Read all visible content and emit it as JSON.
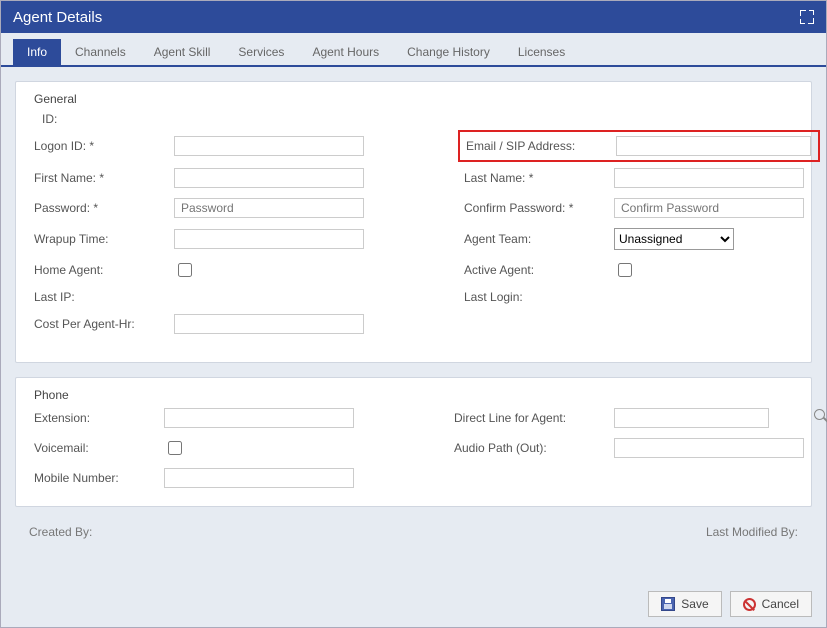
{
  "window": {
    "title": "Agent Details"
  },
  "tabs": [
    {
      "label": "Info",
      "active": true
    },
    {
      "label": "Channels"
    },
    {
      "label": "Agent Skill"
    },
    {
      "label": "Services"
    },
    {
      "label": "Agent Hours"
    },
    {
      "label": "Change History"
    },
    {
      "label": "Licenses"
    }
  ],
  "general": {
    "title": "General",
    "id_label": "ID:",
    "logon_label": "Logon ID: *",
    "email_label": "Email / SIP Address:",
    "firstname_label": "First Name: *",
    "lastname_label": "Last Name: *",
    "password_label": "Password:  *",
    "password_placeholder": "Password",
    "confirm_label": "Confirm Password: *",
    "confirm_placeholder": "Confirm Password",
    "wrapup_label": "Wrapup Time:",
    "team_label": "Agent Team:",
    "team_selected": "Unassigned",
    "home_label": "Home Agent:",
    "active_label": "Active Agent:",
    "lastip_label": "Last IP:",
    "lastlogin_label": "Last Login:",
    "cost_label": "Cost Per Agent-Hr:"
  },
  "phone": {
    "title": "Phone",
    "extension_label": "Extension:",
    "directline_label": "Direct Line for Agent:",
    "voicemail_label": "Voicemail:",
    "audiopath_label": "Audio Path (Out):",
    "mobile_label": "Mobile Number:"
  },
  "meta": {
    "created_label": "Created By:",
    "modified_label": "Last Modified By:"
  },
  "buttons": {
    "save": "Save",
    "cancel": "Cancel"
  }
}
